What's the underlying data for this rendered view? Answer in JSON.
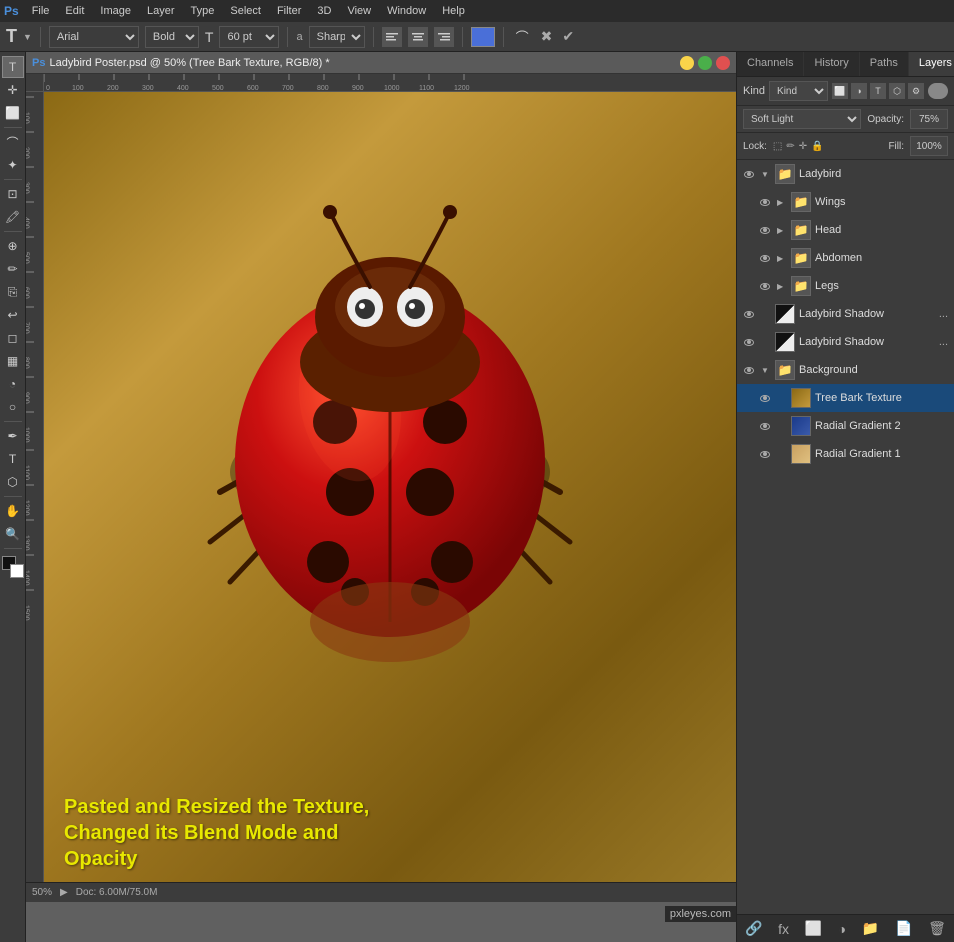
{
  "app": {
    "name": "Adobe Photoshop",
    "ps_icon": "Ps"
  },
  "menu": {
    "items": [
      "File",
      "Edit",
      "Image",
      "Layer",
      "Type",
      "Select",
      "Filter",
      "3D",
      "View",
      "Window",
      "Help"
    ]
  },
  "options_bar": {
    "tool_icon": "T",
    "font_name": "Arial",
    "font_style": "Bold",
    "font_size_icon": "T",
    "font_size": "60 pt",
    "antialiasing_label": "a",
    "antialiasing": "Sharp",
    "align_labels": [
      "left",
      "center",
      "right"
    ],
    "warp_icon": "⌒",
    "cancel_icon": "✖",
    "confirm_icon": "✔"
  },
  "document": {
    "title": "Ladybird Poster.psd @ 50% (Tree Bark Texture, RGB/8) *",
    "zoom": "50%",
    "doc_size": "Doc: 6.00M/75.0M"
  },
  "overlay_text": {
    "line1": "Pasted and Resized the Texture,",
    "line2": "Changed its Blend Mode and",
    "line3": "Opacity"
  },
  "panel_tabs": {
    "channels": "Channels",
    "history": "History",
    "paths": "Paths",
    "layers": "Layers"
  },
  "layers": {
    "filter_label": "Kind",
    "blend_mode": "Soft Light",
    "opacity_label": "Opacity:",
    "opacity_value": "75%",
    "lock_label": "Lock:",
    "fill_label": "Fill:",
    "fill_value": "100%",
    "items": [
      {
        "id": "ladybird-group",
        "name": "Ladybird",
        "type": "group",
        "expanded": true,
        "visible": true,
        "indent": 0,
        "children": [
          {
            "id": "wings",
            "name": "Wings",
            "type": "group",
            "visible": true,
            "indent": 1
          },
          {
            "id": "head",
            "name": "Head",
            "type": "group",
            "visible": true,
            "indent": 1
          },
          {
            "id": "abdomen",
            "name": "Abdomen",
            "type": "group",
            "visible": true,
            "indent": 1
          },
          {
            "id": "legs",
            "name": "Legs",
            "type": "group",
            "visible": true,
            "indent": 1
          }
        ]
      },
      {
        "id": "ladybird-shadow-1",
        "name": "Ladybird Shadow",
        "type": "layer-mask",
        "visible": true,
        "indent": 0,
        "more": "..."
      },
      {
        "id": "ladybird-shadow-2",
        "name": "Ladybird Shadow",
        "type": "layer-mask",
        "visible": true,
        "indent": 0,
        "more": "..."
      },
      {
        "id": "background-group",
        "name": "Background",
        "type": "group",
        "expanded": true,
        "visible": true,
        "indent": 0,
        "children": [
          {
            "id": "tree-bark",
            "name": "Tree Bark Texture",
            "type": "layer",
            "visible": true,
            "indent": 1,
            "active": true,
            "thumb": "bark"
          },
          {
            "id": "radial-gradient-2",
            "name": "Radial Gradient 2",
            "type": "layer",
            "visible": true,
            "indent": 1,
            "thumb": "blue"
          },
          {
            "id": "radial-gradient-1",
            "name": "Radial Gradient 1",
            "type": "layer",
            "visible": true,
            "indent": 1,
            "thumb": "tan"
          }
        ]
      }
    ]
  },
  "status_bar": {
    "zoom": "50%",
    "doc_size": "Doc: 6.00M/75.0M",
    "arrow": "▶"
  },
  "watermark": "pxleyes.com"
}
